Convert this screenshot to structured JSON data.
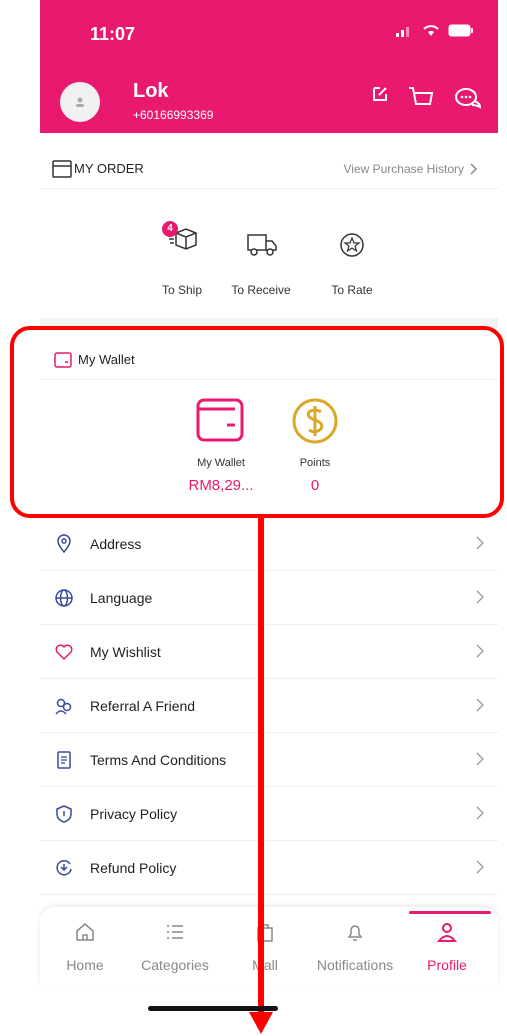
{
  "status": {
    "time": "11:07"
  },
  "user": {
    "name": "Lok",
    "phone": "+60166993369"
  },
  "order": {
    "title": "MY ORDER",
    "view_history": "View Purchase History",
    "items": [
      {
        "label": "To Ship",
        "icon": "box-icon",
        "badge": "4"
      },
      {
        "label": "To Receive",
        "icon": "truck-icon"
      },
      {
        "label": "To Rate",
        "icon": "star-icon"
      }
    ]
  },
  "wallet": {
    "title": "My Wallet",
    "items": [
      {
        "label": "My Wallet",
        "value": "RM8,29...",
        "icon": "wallet-icon"
      },
      {
        "label": "Points",
        "value": "0",
        "icon": "dollar-coin-icon"
      }
    ]
  },
  "menu": [
    {
      "label": "Address",
      "icon": "location-pin-icon"
    },
    {
      "label": "Language",
      "icon": "globe-icon"
    },
    {
      "label": "My Wishlist",
      "icon": "heart-icon"
    },
    {
      "label": "Referral A Friend",
      "icon": "people-icon"
    },
    {
      "label": "Terms And Conditions",
      "icon": "document-icon"
    },
    {
      "label": "Privacy Policy",
      "icon": "shield-icon"
    },
    {
      "label": "Refund Policy",
      "icon": "refund-icon"
    }
  ],
  "tabs": [
    {
      "label": "Home",
      "icon": "home-icon"
    },
    {
      "label": "Categories",
      "icon": "list-icon"
    },
    {
      "label": "Mall",
      "icon": "bag-icon"
    },
    {
      "label": "Notifications",
      "icon": "bell-icon"
    },
    {
      "label": "Profile",
      "icon": "person-icon",
      "active": true
    }
  ],
  "colors": {
    "brand": "#e8196f",
    "annotation": "#ff0000",
    "points": "#d9a92e"
  }
}
